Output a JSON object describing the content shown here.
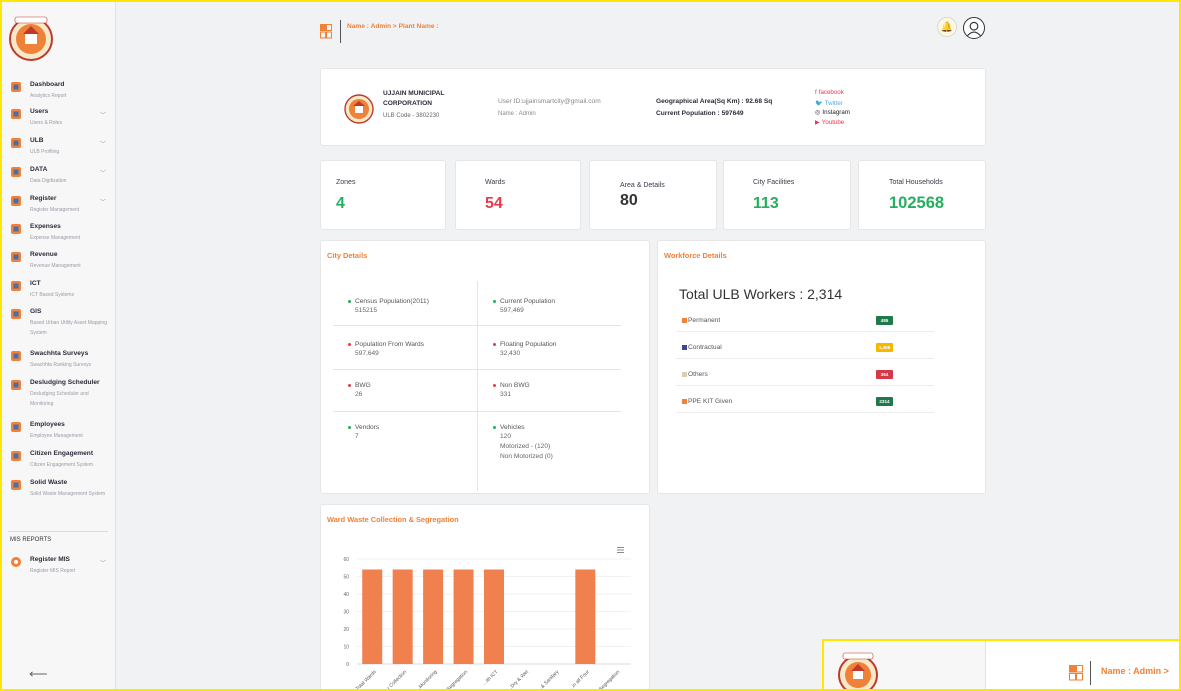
{
  "colors": {
    "accent": "#ef8139",
    "green": "#27ae60",
    "red": "#e53950",
    "workforce_permanent": "#ef8139",
    "workforce_contractual": "#3b4a8c",
    "workforce_others": "#d9cdb3",
    "workforce_ppe": "#ef8139",
    "badge_green": "#1f7a4a",
    "badge_yellow": "#f5b800",
    "badge_red": "#d63848"
  },
  "header": {
    "breadcrumb": "Name : Admin > Plant Name :",
    "grid_icon": "grid-icon",
    "bell_icon": "bell-icon",
    "avatar_icon": "user-avatar-icon"
  },
  "sidebar": {
    "items": [
      {
        "title": "Dashboard",
        "sub": "Analytics Report",
        "icon": "dashboard-icon",
        "expandable": false
      },
      {
        "title": "Users",
        "sub": "Users & Roles",
        "icon": "users-icon",
        "expandable": true
      },
      {
        "title": "ULB",
        "sub": "ULB Profiling",
        "icon": "ulb-icon",
        "expandable": true
      },
      {
        "title": "DATA",
        "sub": "Data Digitization",
        "icon": "data-icon",
        "expandable": true
      },
      {
        "title": "Register",
        "sub": "Register Management",
        "icon": "register-icon",
        "expandable": true
      },
      {
        "title": "Expenses",
        "sub": "Expense Management",
        "icon": "expenses-icon",
        "expandable": false
      },
      {
        "title": "Revenue",
        "sub": "Revenue Management",
        "icon": "revenue-icon",
        "expandable": false
      },
      {
        "title": "ICT",
        "sub": "ICT Based Systems",
        "icon": "ict-icon",
        "expandable": false
      },
      {
        "title": "GIS",
        "sub": "Based Urban Utility Asset Mapping System",
        "icon": "gis-icon",
        "expandable": false
      },
      {
        "title": "Swachhta Surveys",
        "sub": "Swachhta Ranking Surveys",
        "icon": "surveys-icon",
        "expandable": false
      },
      {
        "title": "Desludging Scheduler",
        "sub": "Desludging Scheduler and Monitoring",
        "icon": "desludging-icon",
        "expandable": false
      },
      {
        "title": "Employees",
        "sub": "Employee Management",
        "icon": "employees-icon",
        "expandable": false
      },
      {
        "title": "Citizen Engagement",
        "sub": "Citizen Engagement System",
        "icon": "citizen-icon",
        "expandable": false
      },
      {
        "title": "Solid Waste",
        "sub": "Solid Waste Management System",
        "icon": "solid-waste-icon",
        "expandable": false
      }
    ],
    "section_label": "MIS REPORTS",
    "mis": {
      "title": "Register MIS",
      "sub": "Register MIS Report",
      "icon": "register-mis-icon"
    },
    "back_icon": "arrow-left-icon"
  },
  "profile": {
    "org_name": "UJJAIN MUNICIPAL CORPORATION",
    "ulb_code": "ULB Code - 3802230",
    "user_id": "User ID:ujjainsmartcity@gmail.com",
    "user_name": "Name : Admin",
    "geo_area": "Geographical Area(Sq Km) : 92.68 Sq",
    "population": "Current Population : 597649",
    "social": [
      {
        "label": "facebook",
        "icon": "f",
        "color": "#e53950"
      },
      {
        "label": "Twitter",
        "icon": "🐦",
        "color": "#5aa9e6"
      },
      {
        "label": "Instagram",
        "icon": "◎",
        "color": "#222222"
      },
      {
        "label": "Youtube",
        "icon": "▶",
        "color": "#e53950"
      }
    ]
  },
  "stats": [
    {
      "label": "Zones",
      "value": "4",
      "color": "#27ae60"
    },
    {
      "label": "Wards",
      "value": "54",
      "color": "#e53950"
    },
    {
      "label": "Area & Details",
      "value": "80",
      "color": "#333333"
    },
    {
      "label": "City Facilities",
      "value": "113",
      "color": "#27ae60"
    },
    {
      "label": "Total Households",
      "value": "102568",
      "color": "#27ae60"
    }
  ],
  "city_details": {
    "title": "City Details",
    "cells": [
      {
        "label": "Census Population(2011)",
        "value": "515215",
        "dot": "#27ae60"
      },
      {
        "label": "Current Population",
        "value": "597,469",
        "dot": "#27ae60"
      },
      {
        "label": "Population From Wards",
        "value": "597,649",
        "dot": "#e53950"
      },
      {
        "label": "Floating Population",
        "value": "32,430",
        "dot": "#e53950"
      },
      {
        "label": "BWG",
        "value": "26",
        "dot": "#e53950"
      },
      {
        "label": "Non BWG",
        "value": "331",
        "dot": "#e53950"
      },
      {
        "label": "Vendors",
        "value": "7",
        "dot": "#27ae60"
      },
      {
        "label": "Vehicles",
        "value": "120",
        "value2": "Motorized - (120)",
        "value3": "Non Motorized (0)",
        "dot": "#27ae60"
      }
    ]
  },
  "workforce": {
    "title": "Workforce Details",
    "total": "Total ULB Workers : 2,314",
    "rows": [
      {
        "label": "Permanent",
        "badge": "485",
        "sq": "#ef8139",
        "badge_color": "#1f7a4a"
      },
      {
        "label": "Contractual",
        "badge": "1,465",
        "sq": "#3b4a8c",
        "badge_color": "#f5b800"
      },
      {
        "label": "Others",
        "badge": "364",
        "sq": "#d9cdb3",
        "badge_color": "#d63848"
      },
      {
        "label": "PPE KIT Given",
        "badge": "2314",
        "sq": "#ef8139",
        "badge_color": "#1f7a4a"
      }
    ]
  },
  "ward_waste": {
    "title": "Ward Waste Collection & Segregation",
    "menu_icon": "hamburger-menu-icon"
  },
  "chart_data": {
    "type": "bar",
    "title": "",
    "categories": [
      "Total Wards",
      "Door to Door Collection",
      "Monitoring",
      "Segregation",
      "Wards with ICT",
      "Dry & Wet",
      "& Sanitary",
      "in all Four",
      "Segregation"
    ],
    "category_labels_truncated": [
      "Total Wards",
      "...r Collection",
      "...Monitoring",
      "...Segregation",
      "...ith ICT",
      "...Dry & Wet",
      "...& Sanitary",
      "...in all Four",
      "...Segregation"
    ],
    "values": [
      54,
      54,
      54,
      54,
      54,
      0,
      0,
      54,
      0
    ],
    "ylim": [
      0,
      60
    ],
    "yticks": [
      0,
      10,
      20,
      30,
      40,
      50,
      60
    ],
    "color": "#f0814f",
    "grid": true
  },
  "overlay": {
    "breadcrumb": "Name : Admin >"
  }
}
